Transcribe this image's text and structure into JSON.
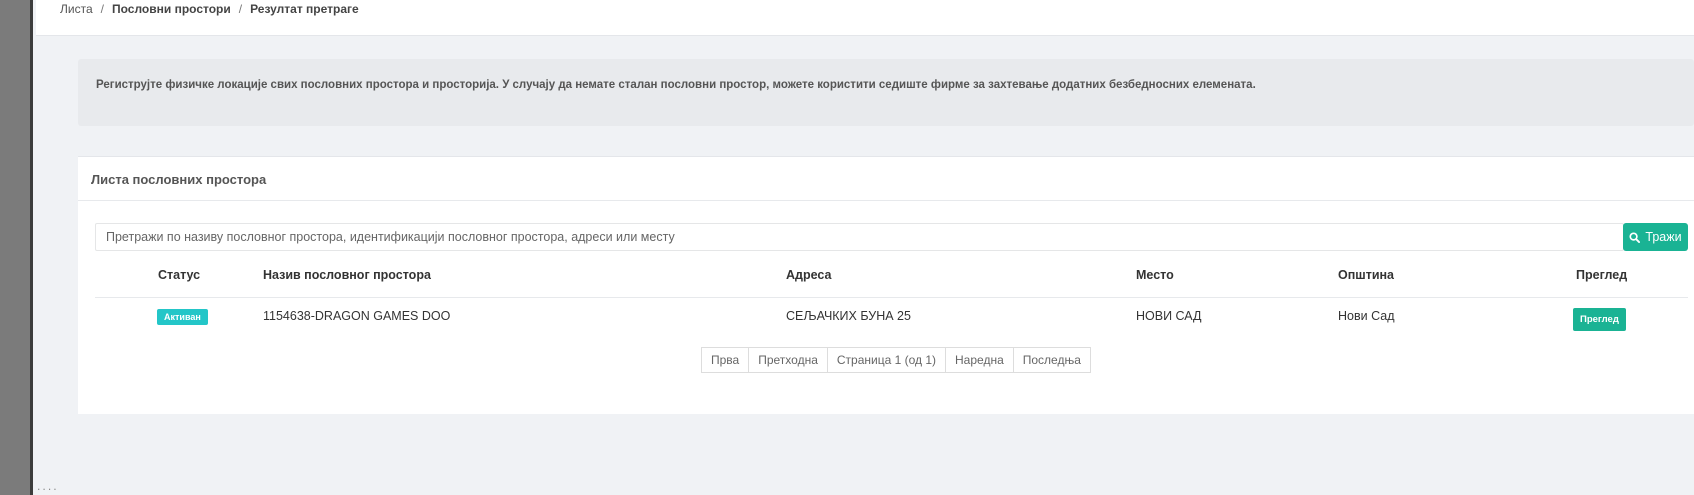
{
  "breadcrumb": {
    "items": [
      "Листа",
      "Пословни простори",
      "Резултат претраге"
    ],
    "separator": "/"
  },
  "info": {
    "message": "Региструјте физичке локације свих пословних простора и просторија. У случају да немате сталан пословни простор, можете користити седиште фирме за захтевање додатних безбедносних елемената."
  },
  "panel": {
    "title": "Листа пословних простора"
  },
  "search": {
    "placeholder": "Претражи по називу пословног простора, идентификацији пословног простора, адреси или месту",
    "value": "",
    "button_label": "Тражи",
    "button_icon": "search-icon",
    "button_color": "#1ab394"
  },
  "table": {
    "headers": {
      "status": "Статус",
      "name": "Назив пословног простора",
      "address": "Адреса",
      "place": "Место",
      "municipality": "Општина",
      "view": "Преглед"
    },
    "rows": [
      {
        "status": "Активан",
        "status_color": "#23c6c8",
        "name": "1154638-DRAGON GAMES DOO",
        "address": "СЕЉАЧКИХ БУНА 25",
        "place": "НОВИ САД",
        "municipality": "Нови Сад",
        "view_label": "Преглед"
      }
    ]
  },
  "pagination": {
    "first": "Прва",
    "previous": "Претходна",
    "current": "Страница 1 (од 1)",
    "next": "Наредна",
    "last": "Последња"
  }
}
